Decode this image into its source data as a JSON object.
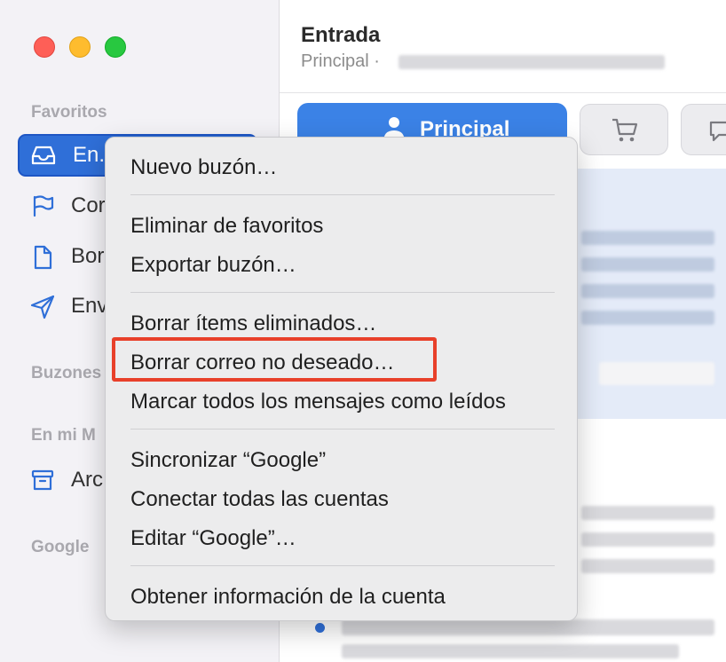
{
  "sidebar": {
    "section_favorites": "Favoritos",
    "section_mailboxes": "Buzones",
    "section_on_my_mac": "En mi M",
    "section_google": "Google",
    "items": [
      {
        "label": "En.",
        "icon": "inbox-icon"
      },
      {
        "label": "Cor",
        "icon": "flag-icon"
      },
      {
        "label": "Bor",
        "icon": "document-icon"
      },
      {
        "label": "Env",
        "icon": "paperplane-icon"
      },
      {
        "label": "Arc",
        "icon": "archive-icon"
      }
    ]
  },
  "main": {
    "title": "Entrada",
    "subtitle": "Principal ·",
    "tabs": {
      "principal_label": "Principal",
      "shopping_icon": "cart-icon",
      "updates_icon": "message-icon"
    }
  },
  "context_menu": {
    "items": [
      "Nuevo buzón…",
      "Eliminar de favoritos",
      "Exportar buzón…",
      "Borrar ítems eliminados…",
      "Borrar correo no deseado…",
      "Marcar todos los mensajes como leídos",
      "Sincronizar “Google”",
      "Conectar todas las cuentas",
      "Editar “Google”…",
      "Obtener información de la cuenta"
    ]
  },
  "colors": {
    "accent": "#2f6fd8",
    "highlight_border": "#e8402a"
  }
}
